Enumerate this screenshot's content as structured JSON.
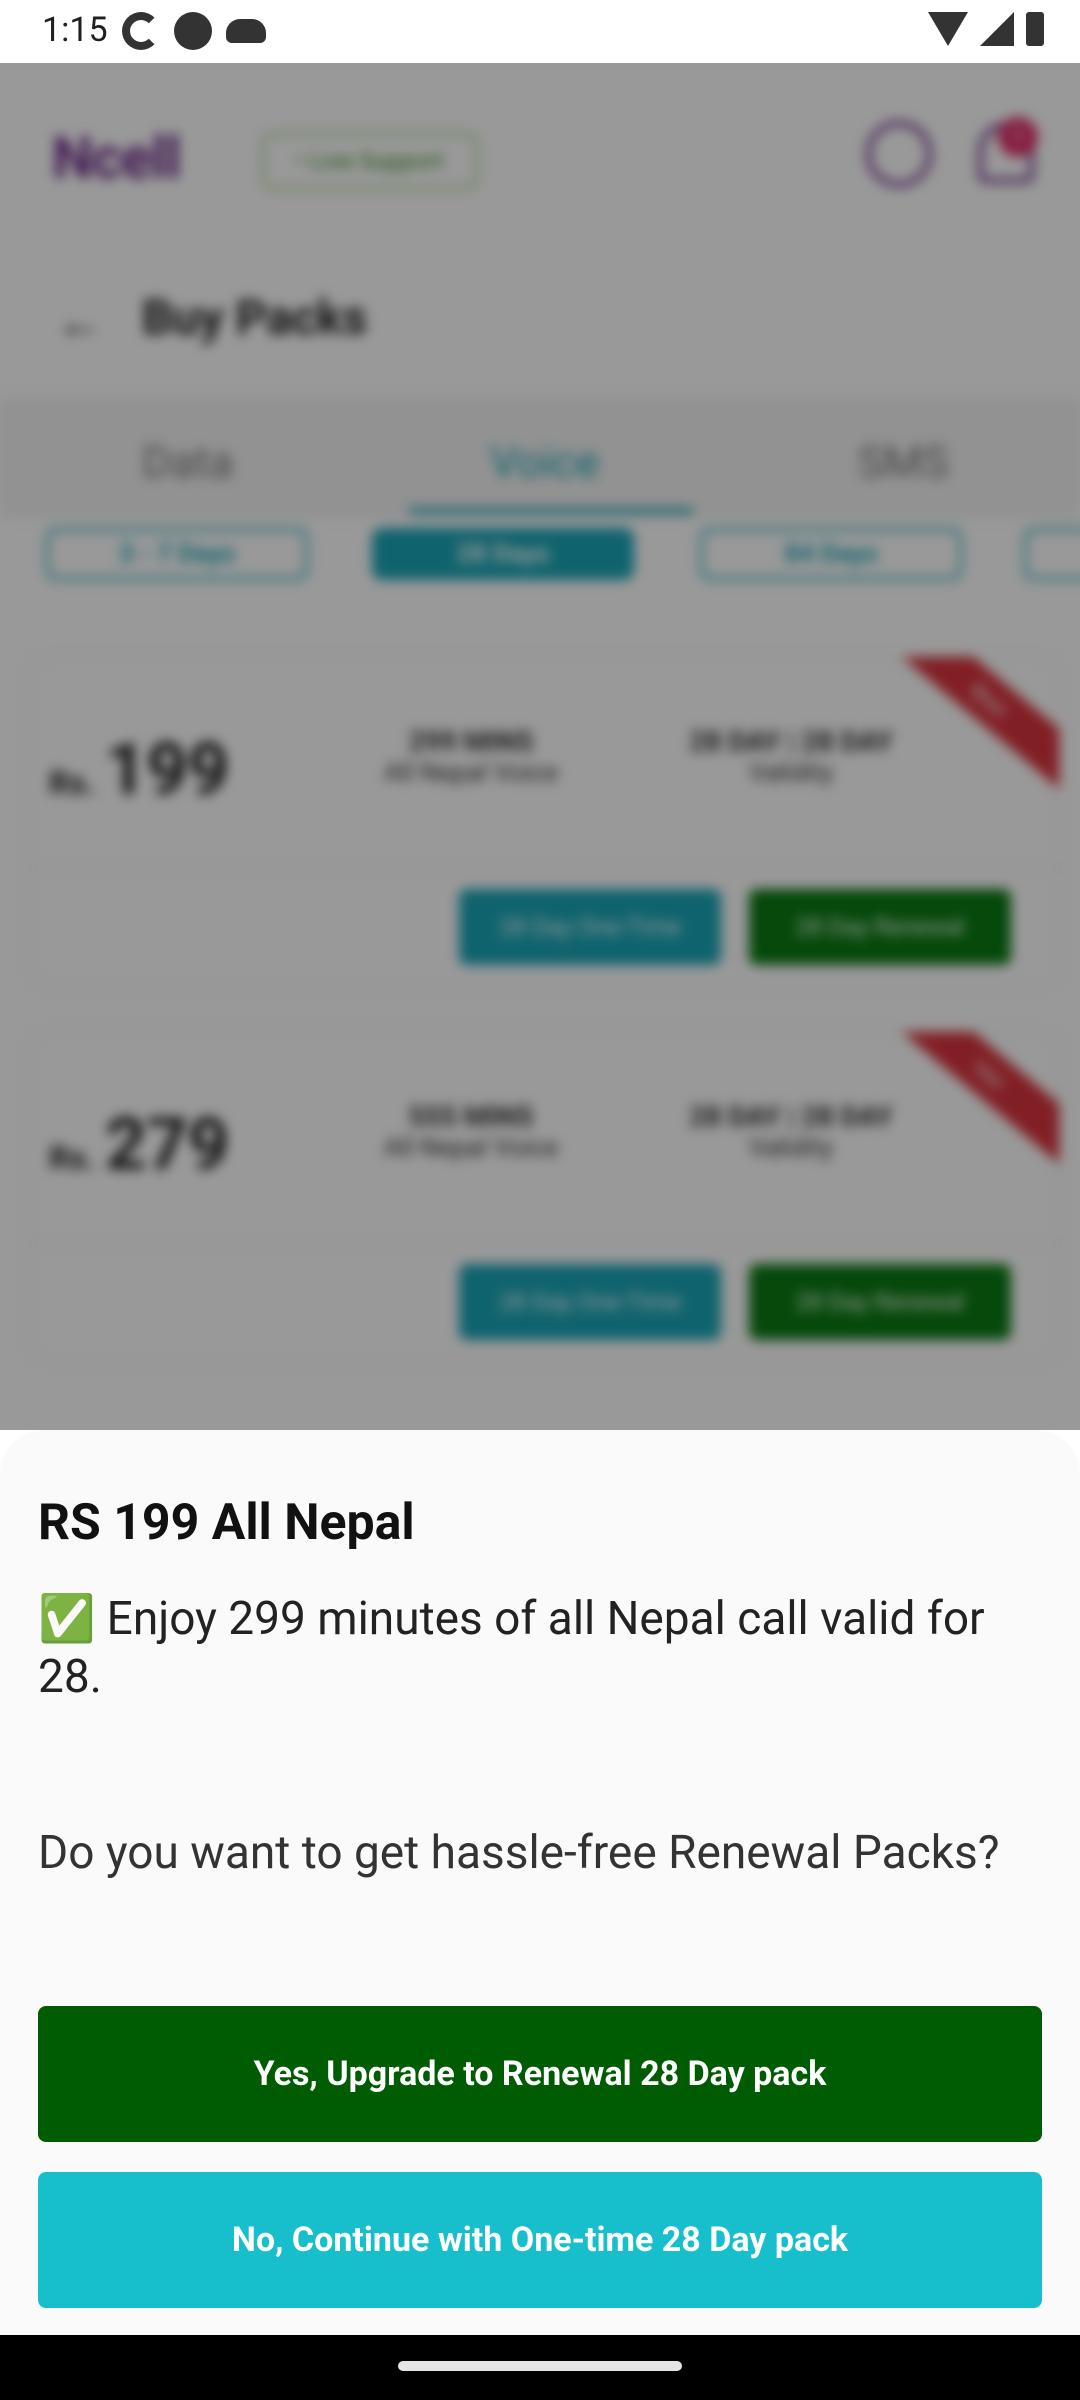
{
  "status_bar": {
    "time": "1:15",
    "icons_left": [
      "sync-icon",
      "circle-icon",
      "cloud-icon"
    ],
    "icons_right": [
      "wifi-icon",
      "signal-icon",
      "battery-icon"
    ]
  },
  "background_app": {
    "logo": "Ncell",
    "live_support": "• Live Support",
    "notification_count": "1",
    "page_title": "Buy Packs",
    "tabs": [
      "Data",
      "Voice",
      "SMS"
    ],
    "active_tab": "Voice",
    "duration_chips": [
      "3 - 7 Days",
      "28 Days",
      "84 Days",
      ""
    ],
    "cards": [
      {
        "currency": "Rs.",
        "price": "199",
        "minutes": "299 MINS",
        "minutes_sub": "All Nepal Voice",
        "validity": "28 DAY | 28 DAY",
        "validity_sub": "Validity",
        "onetime_label": "28 Day One-Time",
        "renewal_label": "28 Day Renewal",
        "ribbon": "Best"
      },
      {
        "currency": "Rs.",
        "price": "279",
        "minutes": "555 MINS",
        "minutes_sub": "All Nepal Voice",
        "validity": "28 DAY | 28 DAY",
        "validity_sub": "Validity",
        "onetime_label": "28 Day One-Time",
        "renewal_label": "28 Day Renewal",
        "ribbon": "Hot"
      }
    ]
  },
  "sheet": {
    "title": "RS 199 All Nepal",
    "description": "✅ Enjoy 299 minutes of all Nepal call valid for 28.",
    "question": "Do you want to get hassle-free Renewal Packs?",
    "renewal_button": "Yes, Upgrade to Renewal 28 Day pack",
    "onetime_button": "No, Continue with One-time 28 Day pack"
  },
  "colors": {
    "renewal_green": "#005c02",
    "onetime_teal": "#16bfcb",
    "brand_purple": "#6d2c8a"
  }
}
